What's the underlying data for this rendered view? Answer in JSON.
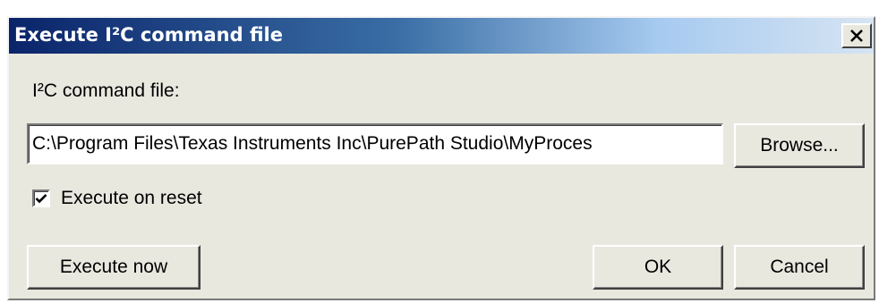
{
  "window": {
    "title": "Execute I²C command file",
    "close_icon": "close-icon"
  },
  "form": {
    "file_label": "I²C command file:",
    "file_path": "C:\\Program Files\\Texas Instruments Inc\\PurePath Studio\\MyProces",
    "browse_label": "Browse...",
    "execute_on_reset_label": "Execute on reset",
    "execute_on_reset_checked": true
  },
  "buttons": {
    "execute_now_label": "Execute now",
    "ok_label": "OK",
    "cancel_label": "Cancel"
  },
  "colors": {
    "titlebar_start": "#0a246a",
    "titlebar_end": "#d6e4f2",
    "dialog_bg": "#e9e8df"
  }
}
